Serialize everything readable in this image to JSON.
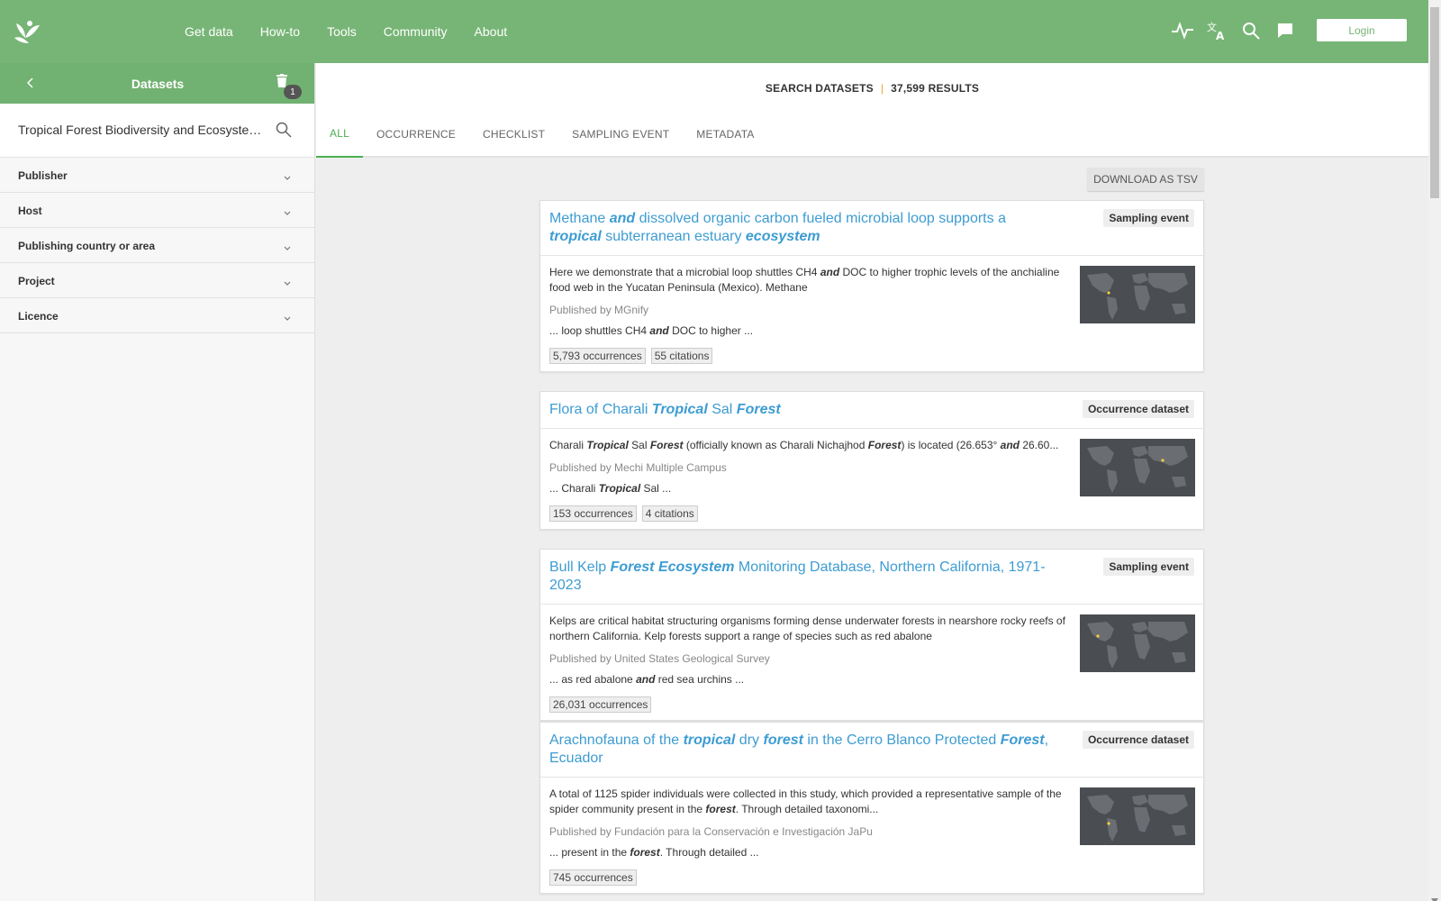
{
  "nav": {
    "items": [
      "Get data",
      "How-to",
      "Tools",
      "Community",
      "About"
    ],
    "login_label": "Login",
    "icons": [
      "pulse-icon",
      "translate-icon",
      "search-icon",
      "feedback-icon"
    ]
  },
  "sidebar": {
    "title": "Datasets",
    "badge_count": "1",
    "search_value": "Tropical Forest Biodiversity and Ecosystem Services",
    "facets": [
      "Publisher",
      "Host",
      "Publishing country or area",
      "Project",
      "Licence"
    ]
  },
  "main": {
    "summary_label": "SEARCH DATASETS",
    "summary_count": "37,599 RESULTS",
    "tabs": [
      "ALL",
      "OCCURRENCE",
      "CHECKLIST",
      "SAMPLING EVENT",
      "METADATA"
    ],
    "download_label": "DOWNLOAD AS TSV"
  },
  "colors": {
    "brand_green": "#77b576",
    "link_blue": "#3d9cd2",
    "accent_orange": "#e5a52a",
    "map_point": "#f4d03f"
  }
}
